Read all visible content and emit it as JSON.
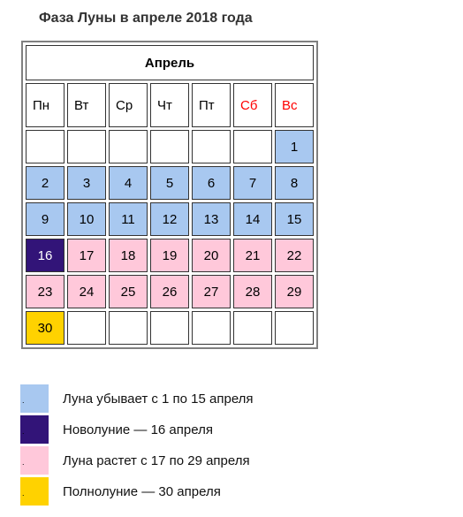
{
  "title": "Фаза Луны в апреле 2018 года",
  "calendar": {
    "month": "Апрель",
    "weekdays": [
      {
        "label": "Пн",
        "color": "#000"
      },
      {
        "label": "Вт",
        "color": "#000"
      },
      {
        "label": "Ср",
        "color": "#000"
      },
      {
        "label": "Чт",
        "color": "#000"
      },
      {
        "label": "Пт",
        "color": "#000"
      },
      {
        "label": "Сб",
        "color": "#ff0000"
      },
      {
        "label": "Вс",
        "color": "#ff0000"
      }
    ],
    "leading_blanks": 6,
    "days_in_month": 30,
    "phases": [
      {
        "from": 1,
        "to": 15,
        "color": "#a8c8f0",
        "text_color": "#000"
      },
      {
        "from": 16,
        "to": 16,
        "color": "#321478",
        "text_color": "#ffffff"
      },
      {
        "from": 17,
        "to": 29,
        "color": "#ffc8da",
        "text_color": "#000"
      },
      {
        "from": 30,
        "to": 30,
        "color": "#ffd200",
        "text_color": "#000"
      }
    ]
  },
  "legend": [
    {
      "marker": ".",
      "label": "Луна убывает с 1 по 15 апреля",
      "color": "#a8c8f0"
    },
    {
      "marker": ".",
      "label": "Новолуние — 16 апреля",
      "color": "#321478"
    },
    {
      "marker": ".",
      "label": "Луна растет с 17 по 29 апреля",
      "color": "#ffc8da"
    },
    {
      "marker": ".",
      "label": "Полнолуние — 30 апреля",
      "color": "#ffd200"
    }
  ]
}
